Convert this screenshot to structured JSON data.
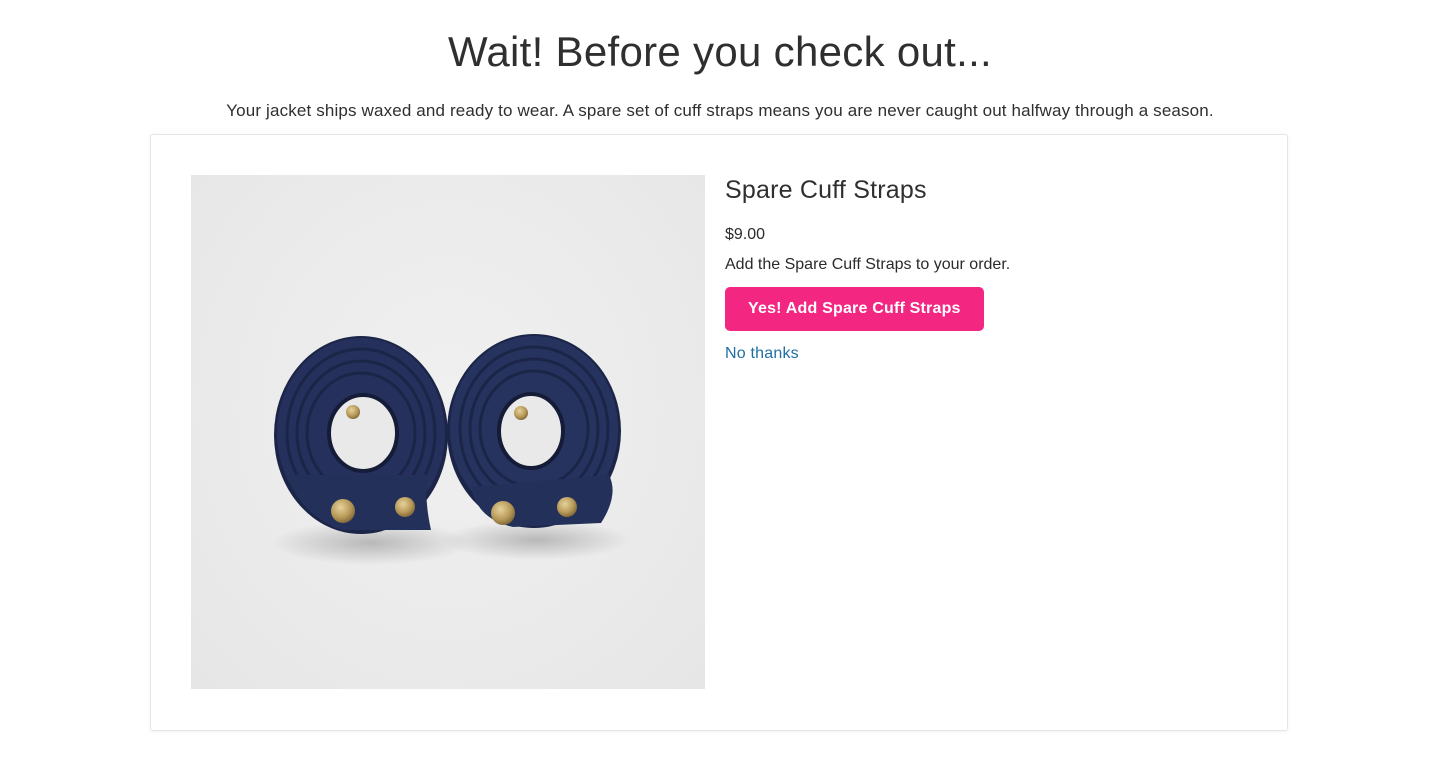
{
  "header": {
    "title": "Wait! Before you check out...",
    "subtitle": "Your jacket ships waxed and ready to wear. A spare set of cuff straps means you are never caught out halfway through a season."
  },
  "offer": {
    "image_alt": "spare-cuff-straps-product-photo",
    "product_name": "Spare Cuff Straps",
    "price": "$9.00",
    "description": "Add the Spare Cuff Straps to your order.",
    "accept_label": "Yes! Add Spare Cuff Straps",
    "decline_label": "No thanks"
  },
  "colors": {
    "accept_button": "#f32682",
    "decline_link": "#1f6fa3",
    "strap_navy": "#1e2a4f",
    "snap_brass": "#b89a5a"
  }
}
